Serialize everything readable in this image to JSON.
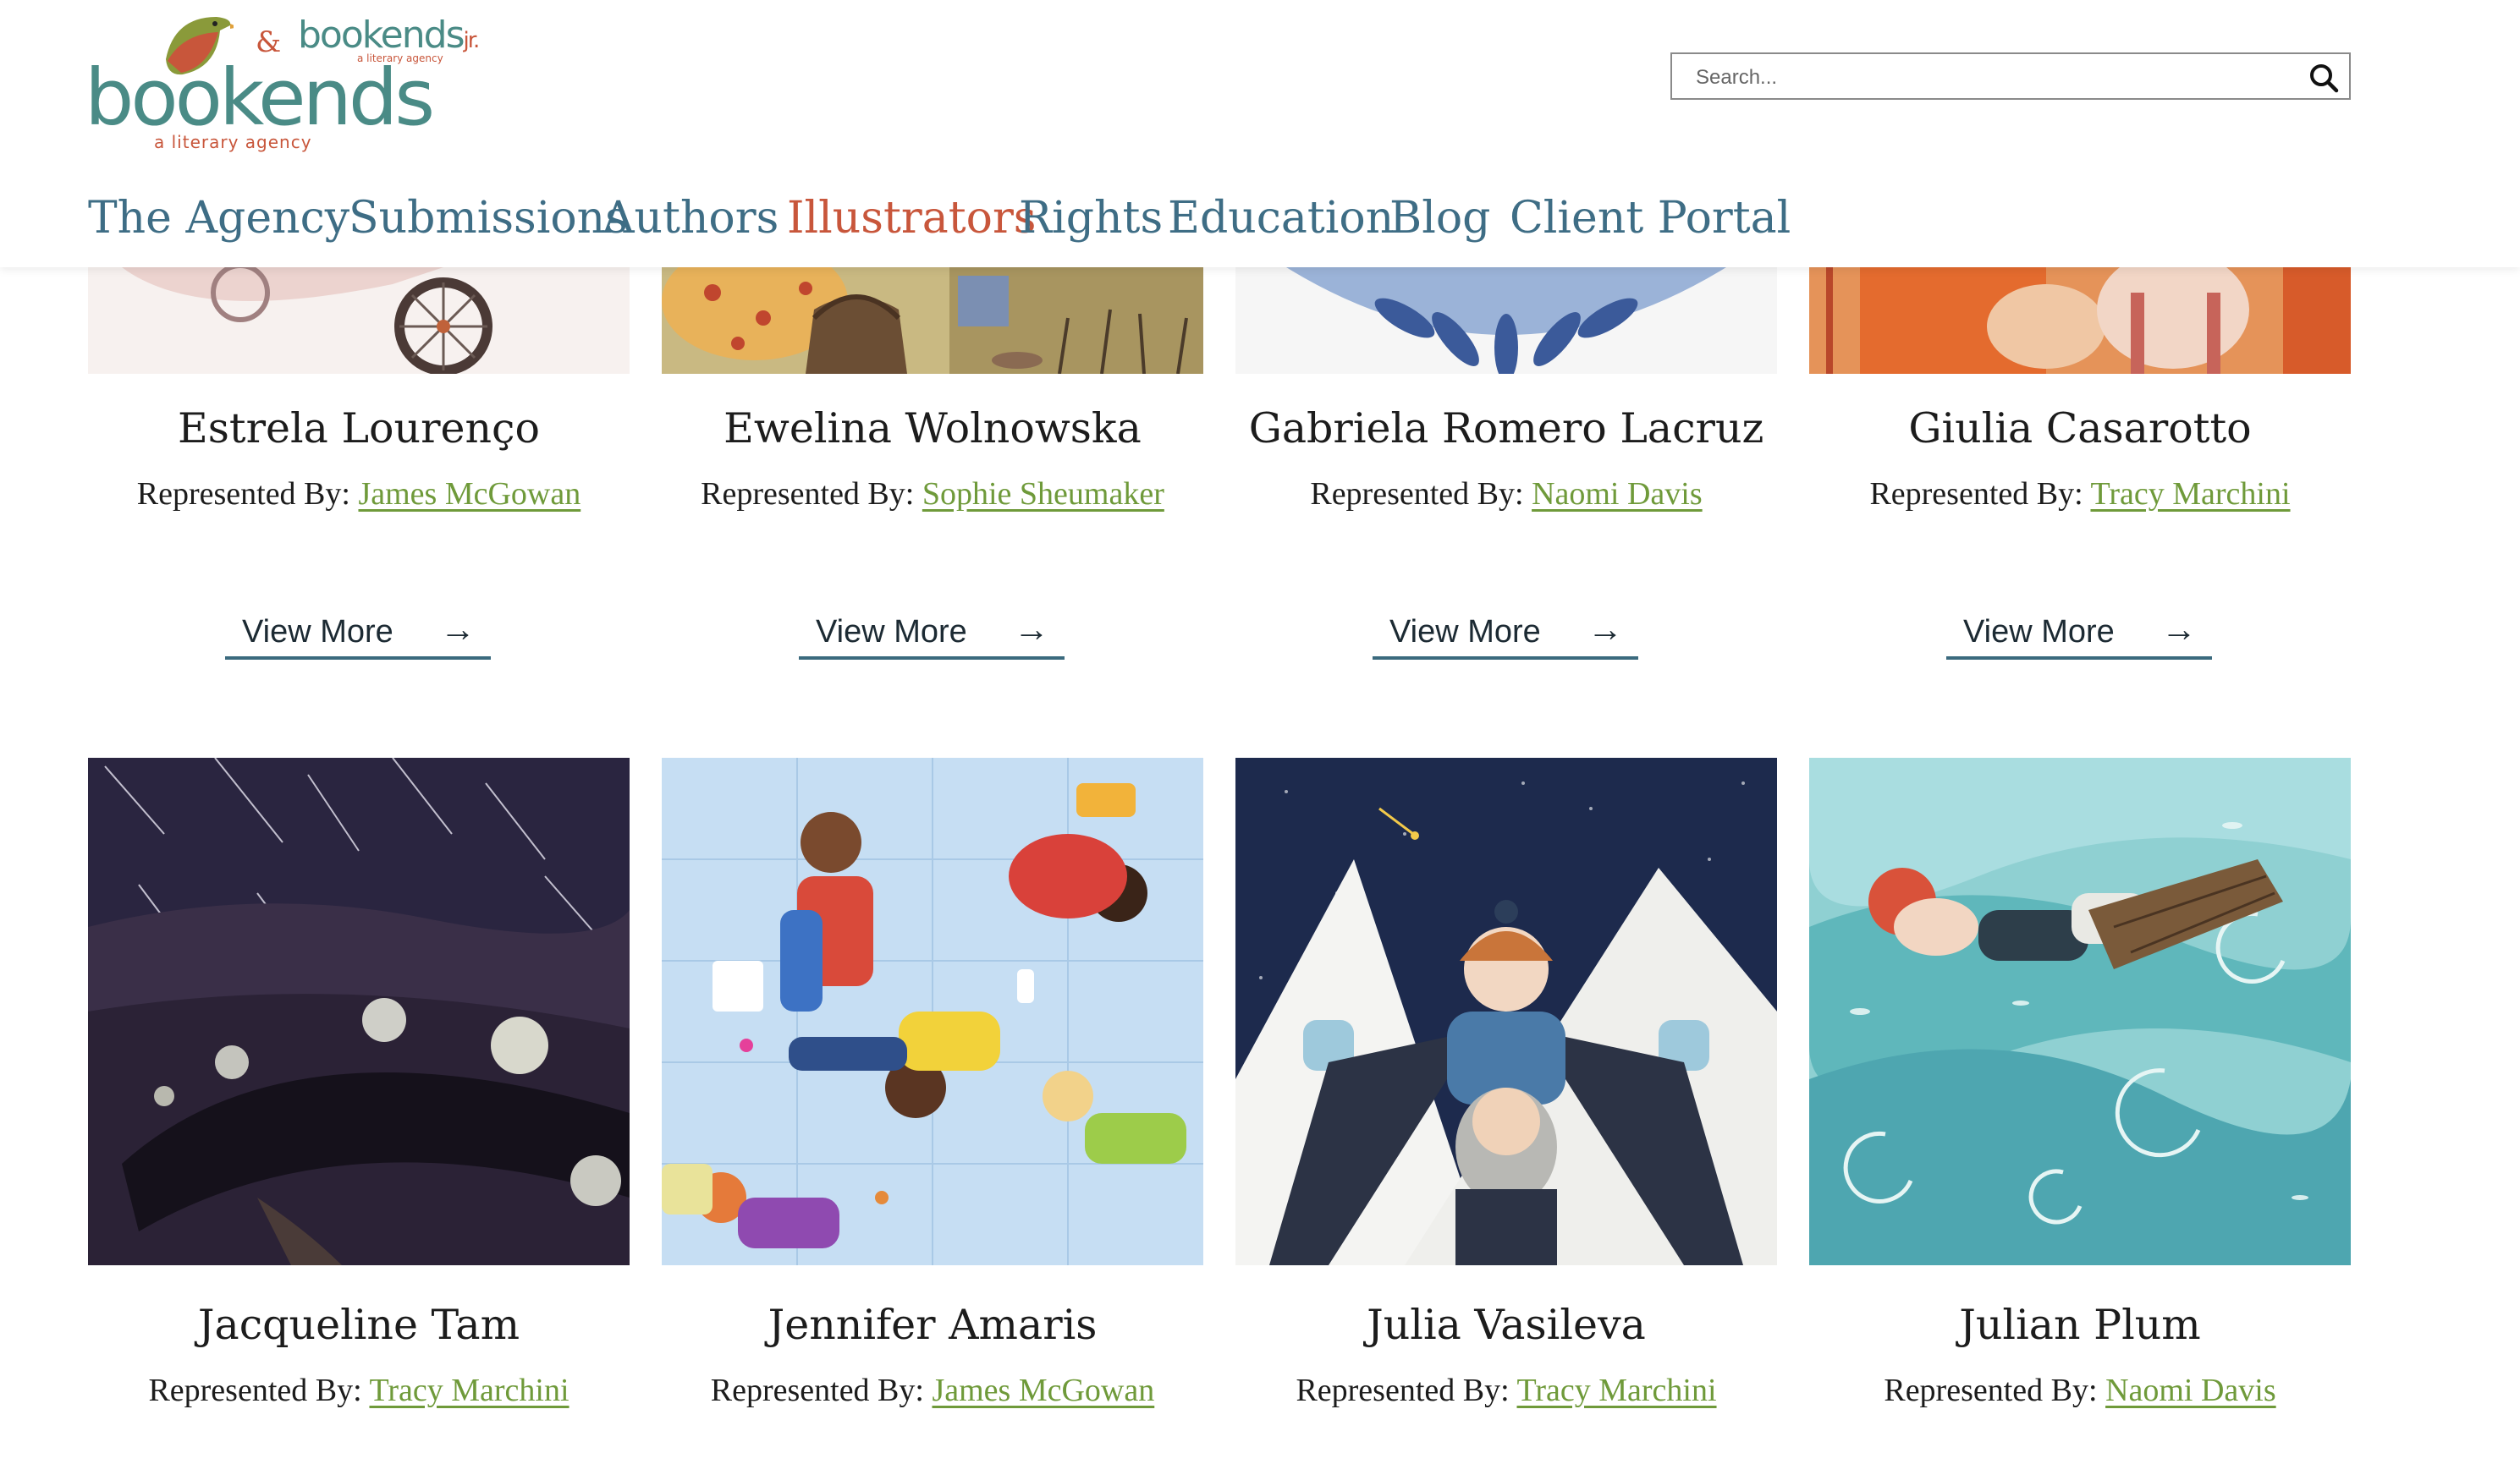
{
  "header": {
    "logo_text": "bookends",
    "logo_tagline": "a literary agency",
    "logo_jr_text": "bookends",
    "logo_jr_suffix": "jr.",
    "logo_jr_tagline": "a literary agency",
    "logo_amp": "&",
    "search_placeholder": "Search...",
    "search_icon": "magnifier-icon",
    "nav": [
      {
        "label": "The Agency",
        "active": false
      },
      {
        "label": "Submissions",
        "active": false
      },
      {
        "label": "Authors",
        "active": false
      },
      {
        "label": "Illustrators",
        "active": true
      },
      {
        "label": "Rights",
        "active": false
      },
      {
        "label": "Education",
        "active": false
      },
      {
        "label": "Blog",
        "active": false
      },
      {
        "label": "Client Portal",
        "active": false
      }
    ]
  },
  "colors": {
    "nav_text": "#3e6d85",
    "nav_active": "#c8563b",
    "agent_link": "#6f9a3a",
    "view_more_underline": "#3b6a7e"
  },
  "illustrators": [
    {
      "name": "Estrela Lourenço",
      "rep_label": "Represented By:",
      "agent": "James McGowan",
      "view_more": "View More",
      "arrow": "→"
    },
    {
      "name": "Ewelina Wolnowska",
      "rep_label": "Represented By:",
      "agent": "Sophie Sheumaker",
      "view_more": "View More",
      "arrow": "→"
    },
    {
      "name": "Gabriela Romero Lacruz",
      "rep_label": "Represented By:",
      "agent": "Naomi Davis",
      "view_more": "View More",
      "arrow": "→"
    },
    {
      "name": "Giulia Casarotto",
      "rep_label": "Represented By:",
      "agent": "Tracy Marchini",
      "view_more": "View More",
      "arrow": "→"
    },
    {
      "name": "Jacqueline Tam",
      "rep_label": "Represented By:",
      "agent": "Tracy Marchini"
    },
    {
      "name": "Jennifer Amaris",
      "rep_label": "Represented By:",
      "agent": "James McGowan"
    },
    {
      "name": "Julia Vasileva",
      "rep_label": "Represented By:",
      "agent": "Tracy Marchini"
    },
    {
      "name": "Julian Plum",
      "rep_label": "Represented By:",
      "agent": "Naomi Davis"
    }
  ]
}
